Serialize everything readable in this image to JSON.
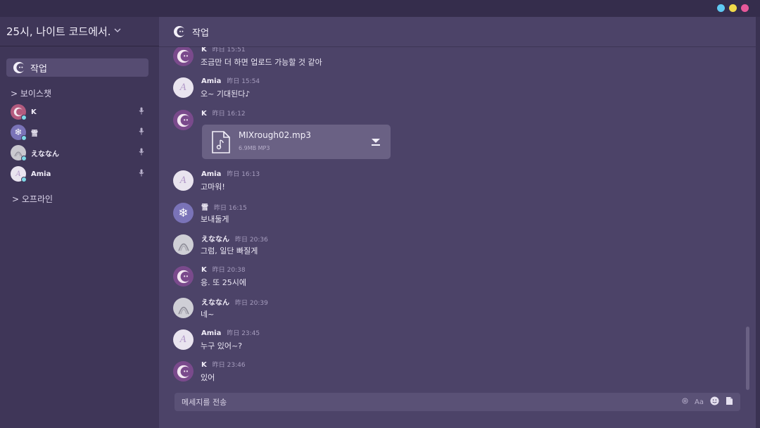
{
  "window": {
    "controls": [
      {
        "name": "blue",
        "color": "#5fc9f2"
      },
      {
        "name": "yellow",
        "color": "#f0d94a"
      },
      {
        "name": "pink",
        "color": "#e7589a"
      }
    ]
  },
  "sidebar": {
    "server_name": "25시, 나이트 코드에서.",
    "active_channel": "작업",
    "voice_section": "> 보이스챗",
    "offline_section": "> 오프라인",
    "voice_members": [
      {
        "name": "K",
        "avatar": "k-avatar"
      },
      {
        "name": "雪",
        "avatar": "snowflake-avatar"
      },
      {
        "name": "えななん",
        "avatar": "enanan-avatar"
      },
      {
        "name": "Amia",
        "avatar": "amia-avatar"
      }
    ]
  },
  "channel": {
    "title": "작업"
  },
  "messages": [
    {
      "author": "K",
      "time": "昨日 15:51",
      "text": "조금만 더 하면 업로드 가능할 것 같아",
      "avatar": "k"
    },
    {
      "author": "Amia",
      "time": "昨日 15:54",
      "text": "오~ 기대된다♪",
      "avatar": "amia"
    },
    {
      "author": "K",
      "time": "昨日 16:12",
      "text": "",
      "avatar": "k",
      "attachment": {
        "filename": "MIXrough02.mp3",
        "meta": "6.9MB MP3"
      }
    },
    {
      "author": "Amia",
      "time": "昨日 16:13",
      "text": "고마워!",
      "avatar": "amia"
    },
    {
      "author": "雪",
      "time": "昨日 16:15",
      "text": "보내둘게",
      "avatar": "yuki"
    },
    {
      "author": "えななん",
      "time": "昨日 20:36",
      "text": "그럼, 일단 빠질게",
      "avatar": "ena"
    },
    {
      "author": "K",
      "time": "昨日 20:38",
      "text": "응. 또 25시에",
      "avatar": "k"
    },
    {
      "author": "えななん",
      "time": "昨日 20:39",
      "text": "네~",
      "avatar": "ena"
    },
    {
      "author": "Amia",
      "time": "昨日 23:45",
      "text": "누구 있어~?",
      "avatar": "amia"
    },
    {
      "author": "K",
      "time": "昨日 23:46",
      "text": "있어",
      "avatar": "k"
    }
  ],
  "composer": {
    "placeholder": "메세지를 전송",
    "tools": [
      "mention-icon",
      "format-text-icon",
      "emoji-icon",
      "file-icon"
    ],
    "format_label": "Aa"
  }
}
